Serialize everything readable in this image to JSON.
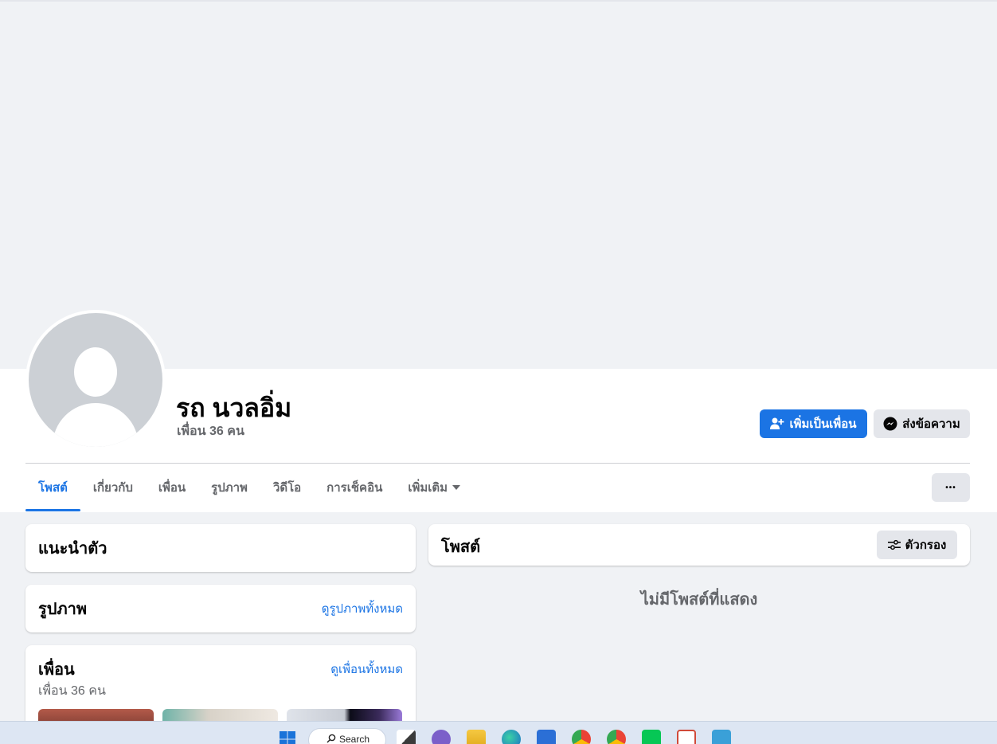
{
  "profile": {
    "name": "รถ นวลอิ่ม",
    "friend_count": "เพื่อน 36 คน"
  },
  "actions": {
    "add_friend": "เพิ่มเป็นเพื่อน",
    "message": "ส่งข้อความ",
    "more": "•••"
  },
  "tabs": [
    {
      "label": "โพสต์",
      "active": true
    },
    {
      "label": "เกี่ยวกับ"
    },
    {
      "label": "เพื่อน"
    },
    {
      "label": "รูปภาพ"
    },
    {
      "label": "วิดีโอ"
    },
    {
      "label": "การเช็คอิน"
    },
    {
      "label": "เพิ่มเติม"
    }
  ],
  "sidebar": {
    "intro_title": "แนะนำตัว",
    "photos_title": "รูปภาพ",
    "photos_link": "ดูรูปภาพทั้งหมด",
    "friends_title": "เพื่อน",
    "friends_link": "ดูเพื่อนทั้งหมด",
    "friends_count": "เพื่อน 36 คน"
  },
  "posts": {
    "title": "โพสต์",
    "filter_label": "ตัวกรอง",
    "empty_message": "ไม่มีโพสต์ที่แสดง"
  },
  "taskbar": {
    "search_label": "Search"
  },
  "colors": {
    "accent": "#1b74e4",
    "page_bg": "#f0f2f5",
    "secondary_text": "#65676b"
  }
}
